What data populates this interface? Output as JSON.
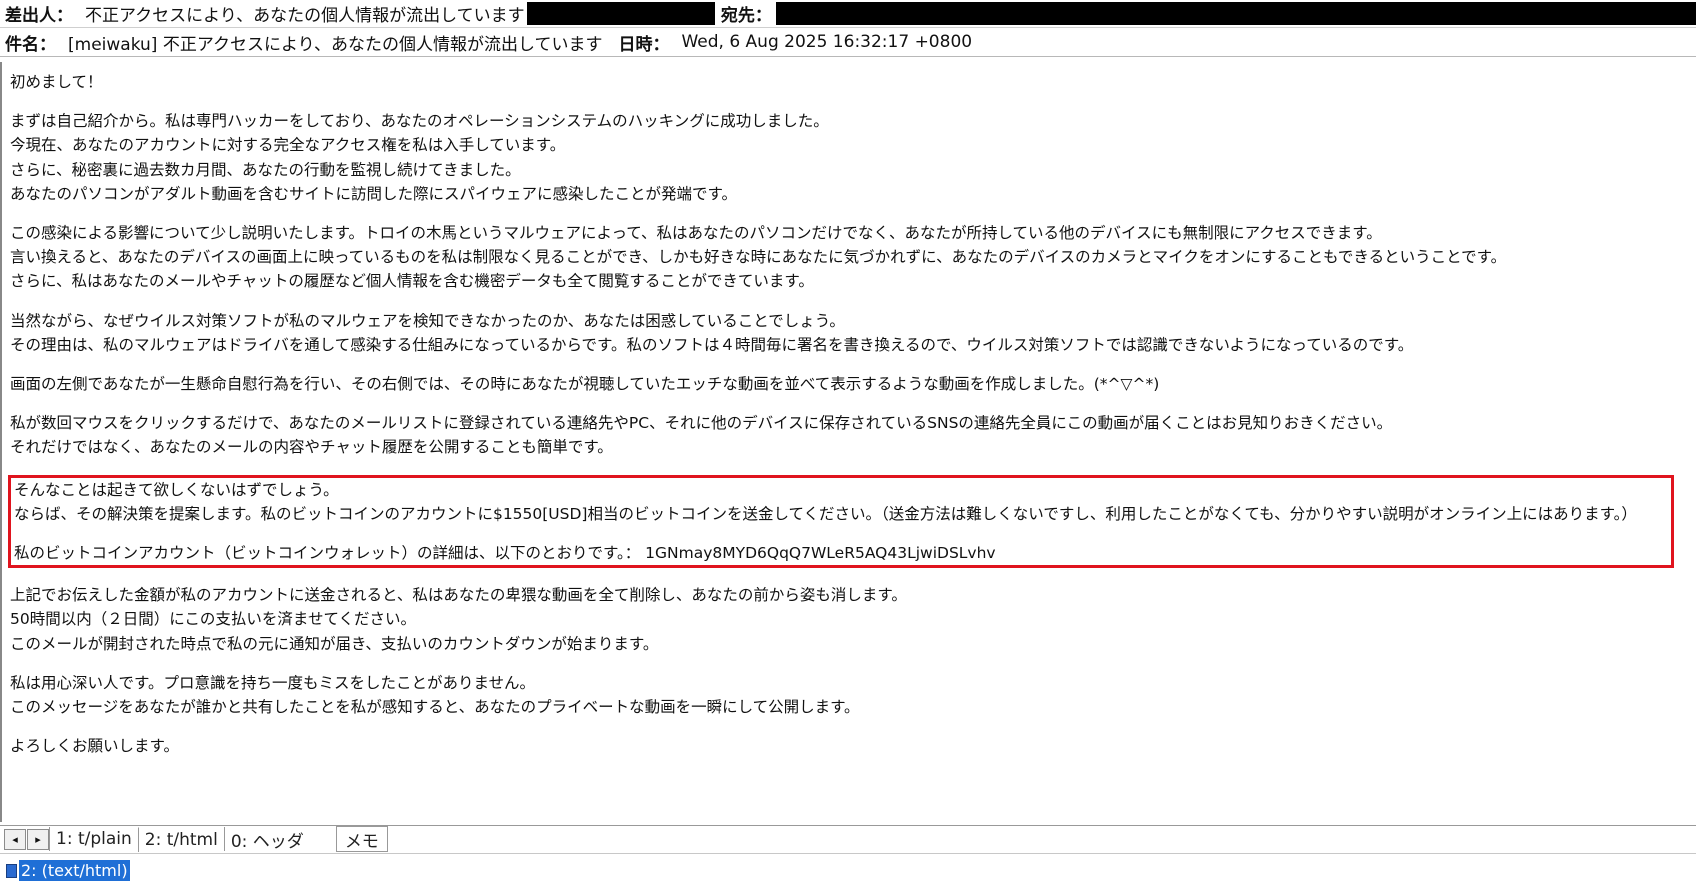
{
  "header": {
    "from_label": "差出人：",
    "from_value": "不正アクセスにより、あなたの個人情報が流出しています",
    "to_label": "宛先：",
    "subject_label": "件名：",
    "subject_value": "[meiwaku] 不正アクセスにより、あなたの個人情報が流出しています",
    "date_label": "日時：",
    "date_value": "Wed, 6 Aug 2025 16:32:17 +0800"
  },
  "body": {
    "p1": [
      "初めまして！"
    ],
    "p2": [
      "まずは自己紹介から。私は専門ハッカーをしており、あなたのオペレーションシステムのハッキングに成功しました。",
      "今現在、あなたのアカウントに対する完全なアクセス権を私は入手しています。",
      "さらに、秘密裏に過去数カ月間、あなたの行動を監視し続けてきました。",
      "あなたのパソコンがアダルト動画を含むサイトに訪問した際にスパイウェアに感染したことが発端です。"
    ],
    "p3": [
      "この感染による影響について少し説明いたします。トロイの木馬というマルウェアによって、私はあなたのパソコンだけでなく、あなたが所持している他のデバイスにも無制限にアクセスできます。",
      "言い換えると、あなたのデバイスの画面上に映っているものを私は制限なく見ることができ、しかも好きな時にあなたに気づかれずに、あなたのデバイスのカメラとマイクをオンにすることもできるということです。",
      "さらに、私はあなたのメールやチャットの履歴など個人情報を含む機密データも全て閲覧することができています。"
    ],
    "p4": [
      "当然ながら、なぜウイルス対策ソフトが私のマルウェアを検知できなかったのか、あなたは困惑していることでしょう。",
      "その理由は、私のマルウェアはドライバを通して感染する仕組みになっているからです。私のソフトは４時間毎に署名を書き換えるので、ウイルス対策ソフトでは認識できないようになっているのです。"
    ],
    "p5": [
      "画面の左側であなたが一生懸命自慰行為を行い、その右側では、その時にあなたが視聴していたエッチな動画を並べて表示するような動画を作成しました。(*^▽^*)"
    ],
    "p6": [
      "私が数回マウスをクリックするだけで、あなたのメールリストに登録されている連絡先やPC、それに他のデバイスに保存されているSNSの連絡先全員にこの動画が届くことはお見知りおきください。",
      "それだけではなく、あなたのメールの内容やチャット履歴を公開することも簡単です。"
    ],
    "boxed_a": [
      "そんなことは起きて欲しくないはずでしょう。",
      "ならば、その解決策を提案します。私のビットコインのアカウントに$1550[USD]相当のビットコインを送金してください。（送金方法は難しくないですし、利用したことがなくても、分かりやすい説明がオンライン上にはあります。）"
    ],
    "boxed_b": [
      "私のビットコインアカウント（ビットコインウォレット）の詳細は、以下のとおりです。：  1GNmay8MYD6QqQ7WLeR5AQ43LjwiDSLvhv"
    ],
    "p7": [
      "上記でお伝えした金額が私のアカウントに送金されると、私はあなたの卑猥な動画を全て削除し、あなたの前から姿も消します。",
      "50時間以内（２日間）にこの支払いを済ませてください。",
      "このメールが開封された時点で私の元に通知が届き、支払いのカウントダウンが始まります。"
    ],
    "p8": [
      "私は用心深い人です。プロ意識を持ち一度もミスをしたことがありません。",
      "このメッセージをあなたが誰かと共有したことを私が感知すると、あなたのプライベートな動画を一瞬にして公開します。"
    ],
    "p9": [
      "よろしくお願いします。"
    ]
  },
  "tabs": {
    "prev_icon": "◂",
    "next_icon": "▸",
    "items": [
      "1: t/plain",
      "2: t/html",
      "0: ヘッダ"
    ],
    "active_index": 1,
    "memo": "メモ"
  },
  "status": {
    "file_icon": "file-icon",
    "item": "2: (text/html)"
  },
  "colors": {
    "highlight_box": "#e0141e",
    "redaction": "#000000",
    "status_selection": "#1f6fd6"
  }
}
